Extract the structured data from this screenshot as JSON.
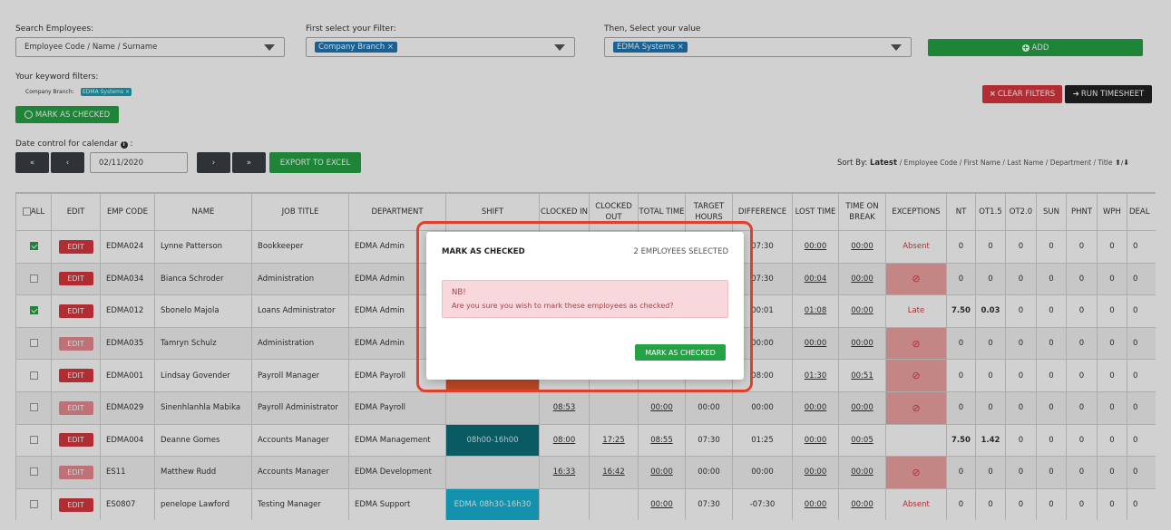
{
  "filters": {
    "search_label": "Search Employees:",
    "search_placeholder": "Employee Code / Name / Surname",
    "filter_label": "First select your Filter:",
    "filter_chip": "Company Branch ×",
    "value_label": "Then, Select your value",
    "value_chip": "EDMA Systems ×",
    "add_label": "ADD",
    "keyword_label": "Your keyword filters:",
    "keyword_key": "Company Branch:",
    "keyword_chip": "EDMA Systems ×",
    "clear_label": "CLEAR FILTERS",
    "run_label": "RUN TIMESHEET",
    "mark_label": "MARK AS CHECKED"
  },
  "date_control": {
    "label": "Date control for calendar",
    "first": "«",
    "prev": "‹",
    "date": "02/11/2020",
    "next": "›",
    "last": "»",
    "export_label": "EXPORT TO EXCEL"
  },
  "sort": {
    "label": "Sort By:",
    "active": "Latest",
    "rest": "/ Employee Code / First Name / Last Name / Department / Title"
  },
  "table": {
    "headers": [
      "ALL",
      "EDIT",
      "EMP CODE",
      "NAME",
      "JOB TITLE",
      "DEPARTMENT",
      "SHIFT",
      "CLOCKED IN",
      "CLOCKED OUT",
      "TOTAL TIME",
      "TARGET HOURS",
      "DIFFERENCE",
      "LOST TIME",
      "TIME ON BREAK",
      "EXCEPTIONS",
      "NT",
      "OT1.5",
      "OT2.0",
      "SUN",
      "PHNT",
      "WPH",
      "DEAL"
    ],
    "edit_label": "EDIT",
    "rows": [
      {
        "checked": true,
        "edit_faded": false,
        "code": "EDMA024",
        "name": "Lynne Patterson",
        "title": "Bookkeeper",
        "dept": "EDMA Admin",
        "shift": "",
        "shift_style": "",
        "in": "",
        "out": "",
        "total": "",
        "target": "",
        "diff": "07:30",
        "lost": "00:00",
        "brk": "00:00",
        "exc": "Absent",
        "exc_type": "text",
        "nt": "0",
        "ot15": "0",
        "ot20": "0",
        "sun": "0",
        "phnt": "0",
        "wph": "0",
        "deal": "0"
      },
      {
        "checked": false,
        "edit_faded": false,
        "code": "EDMA034",
        "name": "Bianca Schroder",
        "title": "Administration",
        "dept": "EDMA Admin",
        "shift": "",
        "shift_style": "",
        "in": "",
        "out": "",
        "total": "",
        "target": "",
        "diff": "07:30",
        "lost": "00:04",
        "brk": "00:00",
        "exc": "",
        "exc_type": "ban",
        "nt": "0",
        "ot15": "0",
        "ot20": "0",
        "sun": "0",
        "phnt": "0",
        "wph": "0",
        "deal": "0"
      },
      {
        "checked": true,
        "edit_faded": false,
        "code": "EDMA012",
        "name": "Sbonelo Majola",
        "title": "Loans Administrator",
        "dept": "EDMA Admin",
        "shift": "",
        "shift_style": "",
        "in": "",
        "out": "",
        "total": "",
        "target": "",
        "diff": "00:01",
        "lost": "01:08",
        "brk": "00:00",
        "exc": "Late",
        "exc_type": "text",
        "nt": "7.50",
        "ot15": "0.03",
        "ot20": "0",
        "sun": "0",
        "phnt": "0",
        "wph": "0",
        "deal": "0"
      },
      {
        "checked": false,
        "edit_faded": true,
        "code": "EDMA035",
        "name": "Tamryn Schulz",
        "title": "Administration",
        "dept": "EDMA Admin",
        "shift": "",
        "shift_style": "",
        "in": "",
        "out": "",
        "total": "",
        "target": "",
        "diff": "00:00",
        "lost": "00:00",
        "brk": "00:00",
        "exc": "",
        "exc_type": "ban",
        "nt": "0",
        "ot15": "0",
        "ot20": "0",
        "sun": "0",
        "phnt": "0",
        "wph": "0",
        "deal": "0"
      },
      {
        "checked": false,
        "edit_faded": false,
        "code": "EDMA001",
        "name": "Lindsay Govender",
        "title": "Payroll Manager",
        "dept": "EDMA Payroll",
        "shift": "",
        "shift_style": "orange",
        "in": "",
        "out": "",
        "total": "",
        "target": "",
        "diff": "08:00",
        "lost": "01:30",
        "brk": "00:51",
        "exc": "",
        "exc_type": "ban",
        "nt": "0",
        "ot15": "0",
        "ot20": "0",
        "sun": "0",
        "phnt": "0",
        "wph": "0",
        "deal": "0"
      },
      {
        "checked": false,
        "edit_faded": true,
        "code": "EDMA029",
        "name": "Sinenhlanhla Mabika",
        "title": "Payroll Administrator",
        "dept": "EDMA Payroll",
        "shift": "",
        "shift_style": "",
        "in": "08:53",
        "out": "",
        "total": "00:00",
        "target": "00:00",
        "diff": "00:00",
        "lost": "00:00",
        "brk": "00:00",
        "exc": "",
        "exc_type": "ban",
        "nt": "0",
        "ot15": "0",
        "ot20": "0",
        "sun": "0",
        "phnt": "0",
        "wph": "0",
        "deal": "0"
      },
      {
        "checked": false,
        "edit_faded": false,
        "code": "EDMA004",
        "name": "Deanne Gomes",
        "title": "Accounts Manager",
        "dept": "EDMA Management",
        "shift": "08h00-16h00",
        "shift_style": "teal",
        "in": "08:00",
        "out": "17:25",
        "total": "08:55",
        "target": "07:30",
        "diff": "01:25",
        "lost": "00:00",
        "brk": "00:05",
        "exc": "",
        "exc_type": "none",
        "nt": "7.50",
        "ot15": "1.42",
        "ot20": "0",
        "sun": "0",
        "phnt": "0",
        "wph": "0",
        "deal": "0"
      },
      {
        "checked": false,
        "edit_faded": true,
        "code": "ES11",
        "name": "Matthew Rudd",
        "title": "Accounts Manager",
        "dept": "EDMA Development",
        "shift": "",
        "shift_style": "",
        "in": "16:33",
        "out": "16:42",
        "total": "00:00",
        "target": "00:00",
        "diff": "00:00",
        "lost": "00:00",
        "brk": "00:00",
        "exc": "",
        "exc_type": "ban",
        "nt": "0",
        "ot15": "0",
        "ot20": "0",
        "sun": "0",
        "phnt": "0",
        "wph": "0",
        "deal": "0"
      },
      {
        "checked": false,
        "edit_faded": false,
        "code": "ES0807",
        "name": "penelope Lawford",
        "title": "Testing Manager",
        "dept": "EDMA Support",
        "shift": "EDMA 08h30-16h30",
        "shift_style": "cyan",
        "in": "",
        "out": "",
        "total": "00:00",
        "target": "07:30",
        "diff": "-07:30",
        "lost": "00:00",
        "brk": "00:00",
        "exc": "Absent",
        "exc_type": "text",
        "nt": "0",
        "ot15": "0",
        "ot20": "0",
        "sun": "0",
        "phnt": "0",
        "wph": "0",
        "deal": "0"
      }
    ]
  },
  "modal": {
    "title": "MARK AS CHECKED",
    "count": "2 EMPLOYEES SELECTED",
    "alert_title": "NB!",
    "alert_text": "Are you sure you wish to mark these employees as checked?",
    "confirm_label": "MARK AS CHECKED"
  }
}
